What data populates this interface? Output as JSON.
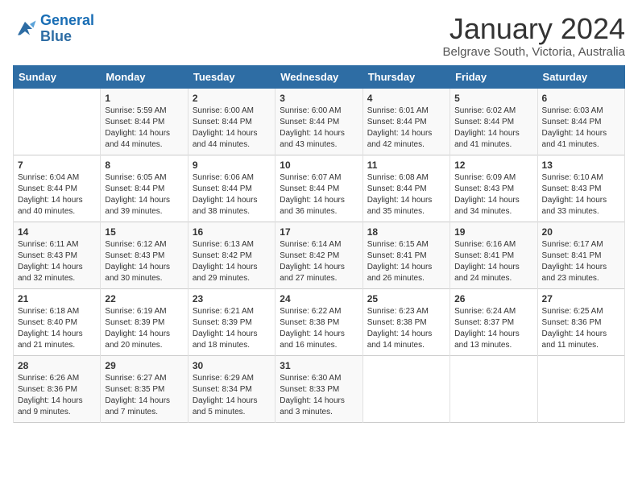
{
  "logo": {
    "line1": "General",
    "line2": "Blue"
  },
  "title": "January 2024",
  "subtitle": "Belgrave South, Victoria, Australia",
  "header_days": [
    "Sunday",
    "Monday",
    "Tuesday",
    "Wednesday",
    "Thursday",
    "Friday",
    "Saturday"
  ],
  "weeks": [
    [
      {
        "num": "",
        "info": ""
      },
      {
        "num": "1",
        "info": "Sunrise: 5:59 AM\nSunset: 8:44 PM\nDaylight: 14 hours\nand 44 minutes."
      },
      {
        "num": "2",
        "info": "Sunrise: 6:00 AM\nSunset: 8:44 PM\nDaylight: 14 hours\nand 44 minutes."
      },
      {
        "num": "3",
        "info": "Sunrise: 6:00 AM\nSunset: 8:44 PM\nDaylight: 14 hours\nand 43 minutes."
      },
      {
        "num": "4",
        "info": "Sunrise: 6:01 AM\nSunset: 8:44 PM\nDaylight: 14 hours\nand 42 minutes."
      },
      {
        "num": "5",
        "info": "Sunrise: 6:02 AM\nSunset: 8:44 PM\nDaylight: 14 hours\nand 41 minutes."
      },
      {
        "num": "6",
        "info": "Sunrise: 6:03 AM\nSunset: 8:44 PM\nDaylight: 14 hours\nand 41 minutes."
      }
    ],
    [
      {
        "num": "7",
        "info": "Sunrise: 6:04 AM\nSunset: 8:44 PM\nDaylight: 14 hours\nand 40 minutes."
      },
      {
        "num": "8",
        "info": "Sunrise: 6:05 AM\nSunset: 8:44 PM\nDaylight: 14 hours\nand 39 minutes."
      },
      {
        "num": "9",
        "info": "Sunrise: 6:06 AM\nSunset: 8:44 PM\nDaylight: 14 hours\nand 38 minutes."
      },
      {
        "num": "10",
        "info": "Sunrise: 6:07 AM\nSunset: 8:44 PM\nDaylight: 14 hours\nand 36 minutes."
      },
      {
        "num": "11",
        "info": "Sunrise: 6:08 AM\nSunset: 8:44 PM\nDaylight: 14 hours\nand 35 minutes."
      },
      {
        "num": "12",
        "info": "Sunrise: 6:09 AM\nSunset: 8:43 PM\nDaylight: 14 hours\nand 34 minutes."
      },
      {
        "num": "13",
        "info": "Sunrise: 6:10 AM\nSunset: 8:43 PM\nDaylight: 14 hours\nand 33 minutes."
      }
    ],
    [
      {
        "num": "14",
        "info": "Sunrise: 6:11 AM\nSunset: 8:43 PM\nDaylight: 14 hours\nand 32 minutes."
      },
      {
        "num": "15",
        "info": "Sunrise: 6:12 AM\nSunset: 8:43 PM\nDaylight: 14 hours\nand 30 minutes."
      },
      {
        "num": "16",
        "info": "Sunrise: 6:13 AM\nSunset: 8:42 PM\nDaylight: 14 hours\nand 29 minutes."
      },
      {
        "num": "17",
        "info": "Sunrise: 6:14 AM\nSunset: 8:42 PM\nDaylight: 14 hours\nand 27 minutes."
      },
      {
        "num": "18",
        "info": "Sunrise: 6:15 AM\nSunset: 8:41 PM\nDaylight: 14 hours\nand 26 minutes."
      },
      {
        "num": "19",
        "info": "Sunrise: 6:16 AM\nSunset: 8:41 PM\nDaylight: 14 hours\nand 24 minutes."
      },
      {
        "num": "20",
        "info": "Sunrise: 6:17 AM\nSunset: 8:41 PM\nDaylight: 14 hours\nand 23 minutes."
      }
    ],
    [
      {
        "num": "21",
        "info": "Sunrise: 6:18 AM\nSunset: 8:40 PM\nDaylight: 14 hours\nand 21 minutes."
      },
      {
        "num": "22",
        "info": "Sunrise: 6:19 AM\nSunset: 8:39 PM\nDaylight: 14 hours\nand 20 minutes."
      },
      {
        "num": "23",
        "info": "Sunrise: 6:21 AM\nSunset: 8:39 PM\nDaylight: 14 hours\nand 18 minutes."
      },
      {
        "num": "24",
        "info": "Sunrise: 6:22 AM\nSunset: 8:38 PM\nDaylight: 14 hours\nand 16 minutes."
      },
      {
        "num": "25",
        "info": "Sunrise: 6:23 AM\nSunset: 8:38 PM\nDaylight: 14 hours\nand 14 minutes."
      },
      {
        "num": "26",
        "info": "Sunrise: 6:24 AM\nSunset: 8:37 PM\nDaylight: 14 hours\nand 13 minutes."
      },
      {
        "num": "27",
        "info": "Sunrise: 6:25 AM\nSunset: 8:36 PM\nDaylight: 14 hours\nand 11 minutes."
      }
    ],
    [
      {
        "num": "28",
        "info": "Sunrise: 6:26 AM\nSunset: 8:36 PM\nDaylight: 14 hours\nand 9 minutes."
      },
      {
        "num": "29",
        "info": "Sunrise: 6:27 AM\nSunset: 8:35 PM\nDaylight: 14 hours\nand 7 minutes."
      },
      {
        "num": "30",
        "info": "Sunrise: 6:29 AM\nSunset: 8:34 PM\nDaylight: 14 hours\nand 5 minutes."
      },
      {
        "num": "31",
        "info": "Sunrise: 6:30 AM\nSunset: 8:33 PM\nDaylight: 14 hours\nand 3 minutes."
      },
      {
        "num": "",
        "info": ""
      },
      {
        "num": "",
        "info": ""
      },
      {
        "num": "",
        "info": ""
      }
    ]
  ]
}
